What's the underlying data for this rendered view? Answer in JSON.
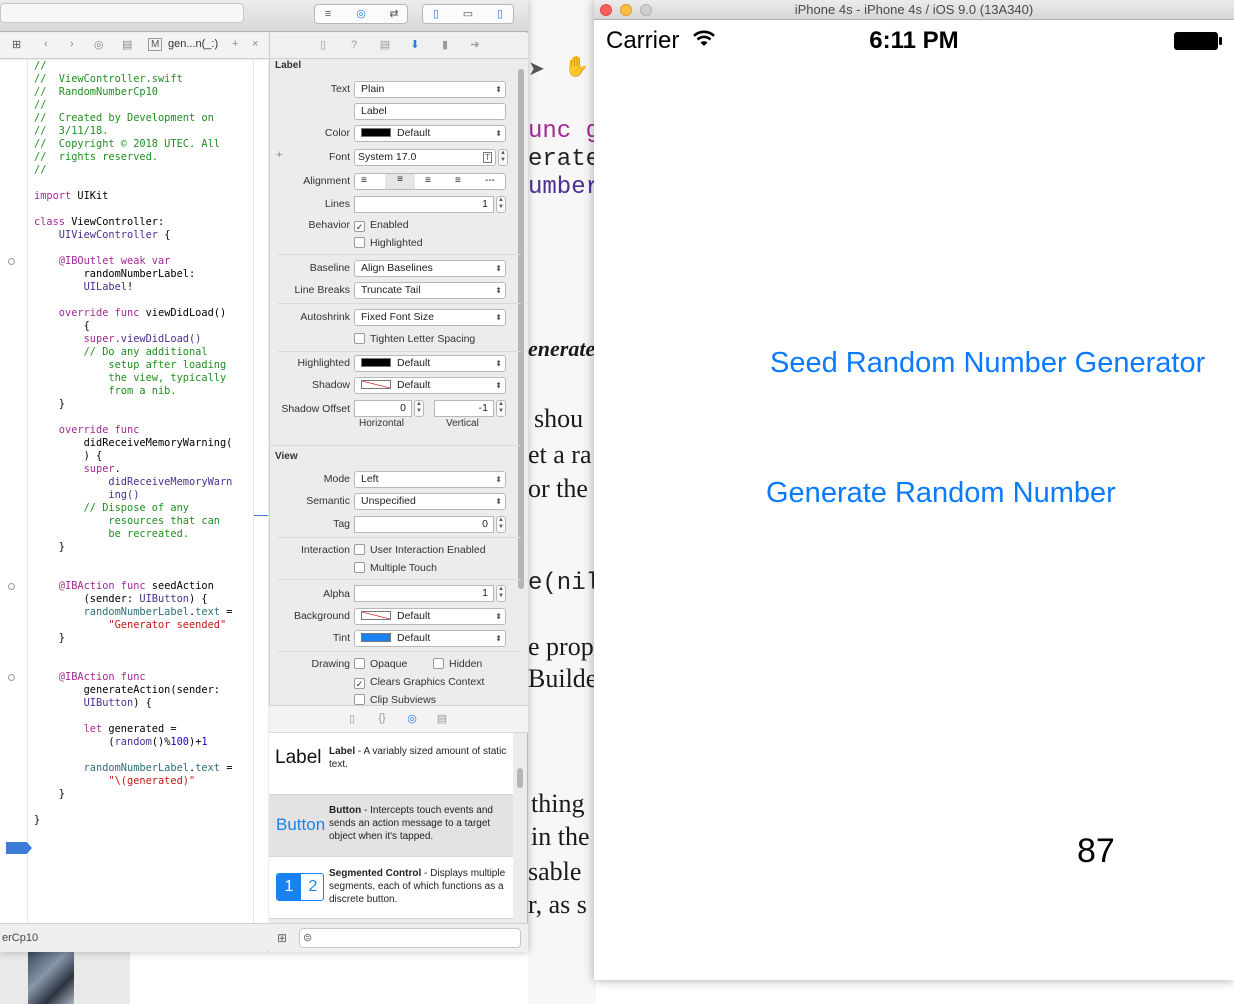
{
  "xcode": {
    "jump_bar": {
      "file_icon": "M",
      "function": "gen...n(_:)"
    },
    "editor": {
      "lines": [
        [
          {
            "t": "//",
            "c": "c-cm"
          }
        ],
        [
          {
            "t": "//  ViewController.swift",
            "c": "c-cm"
          }
        ],
        [
          {
            "t": "//  RandomNumberCp10",
            "c": "c-cm"
          }
        ],
        [
          {
            "t": "//",
            "c": "c-cm"
          }
        ],
        [
          {
            "t": "//  Created by Development on",
            "c": "c-cm"
          }
        ],
        [
          {
            "t": "//  3/11/18.",
            "c": "c-cm"
          }
        ],
        [
          {
            "t": "//  Copyright © 2018 UTEC. All",
            "c": "c-cm"
          }
        ],
        [
          {
            "t": "//  rights reserved.",
            "c": "c-cm"
          }
        ],
        [
          {
            "t": "//",
            "c": "c-cm"
          }
        ],
        [
          {
            "t": "",
            "c": ""
          }
        ],
        [
          {
            "t": "import",
            "c": "c-kw"
          },
          {
            "t": " UIKit",
            "c": ""
          }
        ],
        [
          {
            "t": "",
            "c": ""
          }
        ],
        [
          {
            "t": "class",
            "c": "c-kw"
          },
          {
            "t": " ViewController:",
            "c": ""
          }
        ],
        [
          {
            "t": "    UIViewController",
            "c": "c-ty"
          },
          {
            "t": " {",
            "c": ""
          }
        ],
        [
          {
            "t": "",
            "c": ""
          }
        ],
        [
          {
            "t": "    @IBOutlet weak var",
            "c": "c-kw"
          }
        ],
        [
          {
            "t": "        randomNumberLabel:",
            "c": ""
          }
        ],
        [
          {
            "t": "        UILabel",
            "c": "c-ty"
          },
          {
            "t": "!",
            "c": ""
          }
        ],
        [
          {
            "t": "",
            "c": ""
          }
        ],
        [
          {
            "t": "    override func",
            "c": "c-kw"
          },
          {
            "t": " viewDidLoad()",
            "c": ""
          }
        ],
        [
          {
            "t": "        {",
            "c": ""
          }
        ],
        [
          {
            "t": "        super",
            "c": "c-kw"
          },
          {
            "t": ".viewDidLoad()",
            "c": "c-ty"
          }
        ],
        [
          {
            "t": "        // Do any additional",
            "c": "c-cm"
          }
        ],
        [
          {
            "t": "            setup after loading",
            "c": "c-cm"
          }
        ],
        [
          {
            "t": "            the view, typically",
            "c": "c-cm"
          }
        ],
        [
          {
            "t": "            from a nib.",
            "c": "c-cm"
          }
        ],
        [
          {
            "t": "    }",
            "c": ""
          }
        ],
        [
          {
            "t": "",
            "c": ""
          }
        ],
        [
          {
            "t": "    override func",
            "c": "c-kw"
          }
        ],
        [
          {
            "t": "        didReceiveMemoryWarning(",
            "c": ""
          }
        ],
        [
          {
            "t": "        ) {",
            "c": ""
          }
        ],
        [
          {
            "t": "        super",
            "c": "c-kw"
          },
          {
            "t": ".",
            "c": ""
          }
        ],
        [
          {
            "t": "            didReceiveMemoryWarn",
            "c": "c-ty"
          }
        ],
        [
          {
            "t": "            ing()",
            "c": "c-ty"
          }
        ],
        [
          {
            "t": "        // Dispose of any",
            "c": "c-cm"
          }
        ],
        [
          {
            "t": "            resources that can",
            "c": "c-cm"
          }
        ],
        [
          {
            "t": "            be recreated.",
            "c": "c-cm"
          }
        ],
        [
          {
            "t": "    }",
            "c": ""
          }
        ],
        [
          {
            "t": "",
            "c": ""
          }
        ],
        [
          {
            "t": "",
            "c": ""
          }
        ],
        [
          {
            "t": "    @IBAction func",
            "c": "c-kw"
          },
          {
            "t": " seedAction",
            "c": ""
          }
        ],
        [
          {
            "t": "        (sender: ",
            "c": ""
          },
          {
            "t": "UIButton",
            "c": "c-ty"
          },
          {
            "t": ") {",
            "c": ""
          }
        ],
        [
          {
            "t": "        randomNumberLabel",
            "c": "c-fn"
          },
          {
            "t": ".",
            "c": ""
          },
          {
            "t": "text",
            "c": "c-fn"
          },
          {
            "t": " =",
            "c": ""
          }
        ],
        [
          {
            "t": "            \"Generator seended\"",
            "c": "c-st"
          }
        ],
        [
          {
            "t": "    }",
            "c": ""
          }
        ],
        [
          {
            "t": "",
            "c": ""
          }
        ],
        [
          {
            "t": "",
            "c": ""
          }
        ],
        [
          {
            "t": "    @IBAction func",
            "c": "c-kw"
          }
        ],
        [
          {
            "t": "        generateAction(sender:",
            "c": ""
          }
        ],
        [
          {
            "t": "        UIButton",
            "c": "c-ty"
          },
          {
            "t": ") {",
            "c": ""
          }
        ],
        [
          {
            "t": "",
            "c": ""
          }
        ],
        [
          {
            "t": "        let",
            "c": "c-kw"
          },
          {
            "t": " generated =",
            "c": ""
          }
        ],
        [
          {
            "t": "            (",
            "c": ""
          },
          {
            "t": "random",
            "c": "c-ty"
          },
          {
            "t": "()%",
            "c": ""
          },
          {
            "t": "100",
            "c": "c-nm"
          },
          {
            "t": ")+",
            "c": ""
          },
          {
            "t": "1",
            "c": "c-nm"
          }
        ],
        [
          {
            "t": "",
            "c": ""
          }
        ],
        [
          {
            "t": "        randomNumberLabel",
            "c": "c-fn"
          },
          {
            "t": ".",
            "c": ""
          },
          {
            "t": "text",
            "c": "c-fn"
          },
          {
            "t": " =",
            "c": ""
          }
        ],
        [
          {
            "t": "            \"\\(generated)\"",
            "c": "c-st"
          }
        ],
        [
          {
            "t": "    }",
            "c": ""
          }
        ],
        [
          {
            "t": "",
            "c": ""
          }
        ],
        [
          {
            "t": "}",
            "c": ""
          }
        ]
      ]
    },
    "status_project": "erCp10",
    "inspector": {
      "label_section": "Label",
      "text_label": "Text",
      "text_value": "Plain",
      "label_text_value": "Label",
      "color_label": "Color",
      "color_value": "Default",
      "font_label": "Font",
      "font_value": "System 17.0",
      "alignment_label": "Alignment",
      "lines_label": "Lines",
      "lines_value": "1",
      "behavior_label": "Behavior",
      "enabled": "Enabled",
      "highlighted_chk": "Highlighted",
      "baseline_label": "Baseline",
      "baseline_value": "Align Baselines",
      "linebreaks_label": "Line Breaks",
      "linebreaks_value": "Truncate Tail",
      "autoshrink_label": "Autoshrink",
      "autoshrink_value": "Fixed Font Size",
      "tighten": "Tighten Letter Spacing",
      "highlighted_label": "Highlighted",
      "highlighted_value": "Default",
      "shadow_label": "Shadow",
      "shadow_value": "Default",
      "shadow_offset_label": "Shadow Offset",
      "shadow_h": "0",
      "shadow_v": "-1",
      "horizontal": "Horizontal",
      "vertical": "Vertical",
      "view_section": "View",
      "mode_label": "Mode",
      "mode_value": "Left",
      "semantic_label": "Semantic",
      "semantic_value": "Unspecified",
      "tag_label": "Tag",
      "tag_value": "0",
      "interaction_label": "Interaction",
      "user_interaction": "User Interaction Enabled",
      "multiple_touch": "Multiple Touch",
      "alpha_label": "Alpha",
      "alpha_value": "1",
      "background_label": "Background",
      "background_value": "Default",
      "tint_label": "Tint",
      "tint_value": "Default",
      "drawing_label": "Drawing",
      "opaque": "Opaque",
      "hidden": "Hidden",
      "clears": "Clears Graphics Context",
      "clip": "Clip Subviews"
    },
    "library": [
      {
        "icon": "Label",
        "name": "Label",
        "desc": " - A variably sized amount of static text."
      },
      {
        "icon": "Button",
        "name": "Button",
        "desc": " - Intercepts touch events and sends an action message to a target object when it's tapped."
      },
      {
        "icon_1": "1",
        "icon_2": "2",
        "name": "Segmented Control",
        "desc": " - Displays multiple segments, each of which functions as a discrete button."
      }
    ]
  },
  "background_doc": {
    "code_1": "unc g",
    "code_2": "erate",
    "code_3": "umber",
    "italic": "enerate",
    "lines": [
      "shou",
      "et a ra",
      "or the"
    ],
    "code_4": "e(nil",
    "lines2": [
      "e prop",
      "Builder"
    ],
    "lines3": [
      "thing",
      "in the",
      "sable",
      "r, as s"
    ]
  },
  "simulator": {
    "title": "iPhone 4s - iPhone 4s / iOS 9.0 (13A340)",
    "carrier": "Carrier",
    "time": "6:11 PM",
    "seed_button": "Seed Random Number Generator",
    "generate_button": "Generate Random Number",
    "result_label": "87",
    "accent_color": "#0a7aff"
  }
}
